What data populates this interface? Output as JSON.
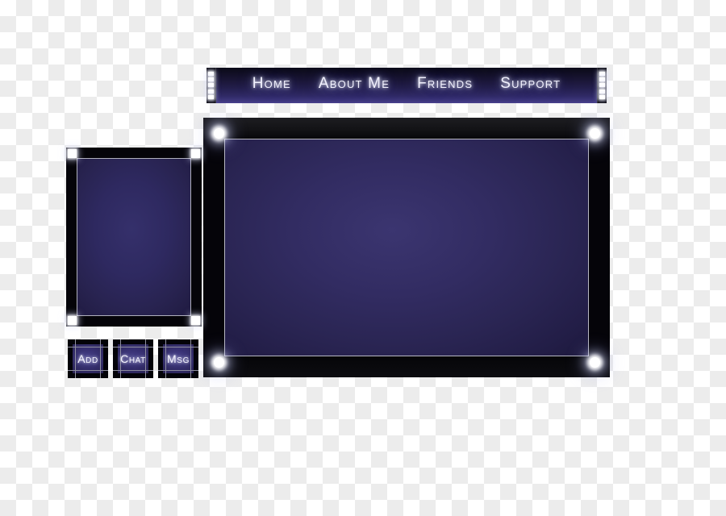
{
  "theme": {
    "panel_black": "#050409",
    "panel_indigo": "#2e2a5c",
    "accent_purple": "#413a80",
    "glow_white": "#ffffff",
    "border_light": "#b9b9c4",
    "canvas_checker_light": "#ffffff",
    "canvas_checker_dark": "#ececec"
  },
  "navbar": {
    "name": "main-navigation",
    "links": [
      {
        "label": "Home"
      },
      {
        "label": "About Me"
      },
      {
        "label": "Friends"
      },
      {
        "label": "Support"
      }
    ],
    "rail_light_count": 5
  },
  "main_panel": {
    "name": "content-panel",
    "content": "",
    "corner_orbs": 4
  },
  "side_panel": {
    "name": "profile-panel",
    "content": "",
    "corner_orbs": 4
  },
  "buttons": [
    {
      "label": "Add",
      "name": "add-button"
    },
    {
      "label": "Chat",
      "name": "chat-button"
    },
    {
      "label": "Msg",
      "name": "msg-button"
    }
  ]
}
